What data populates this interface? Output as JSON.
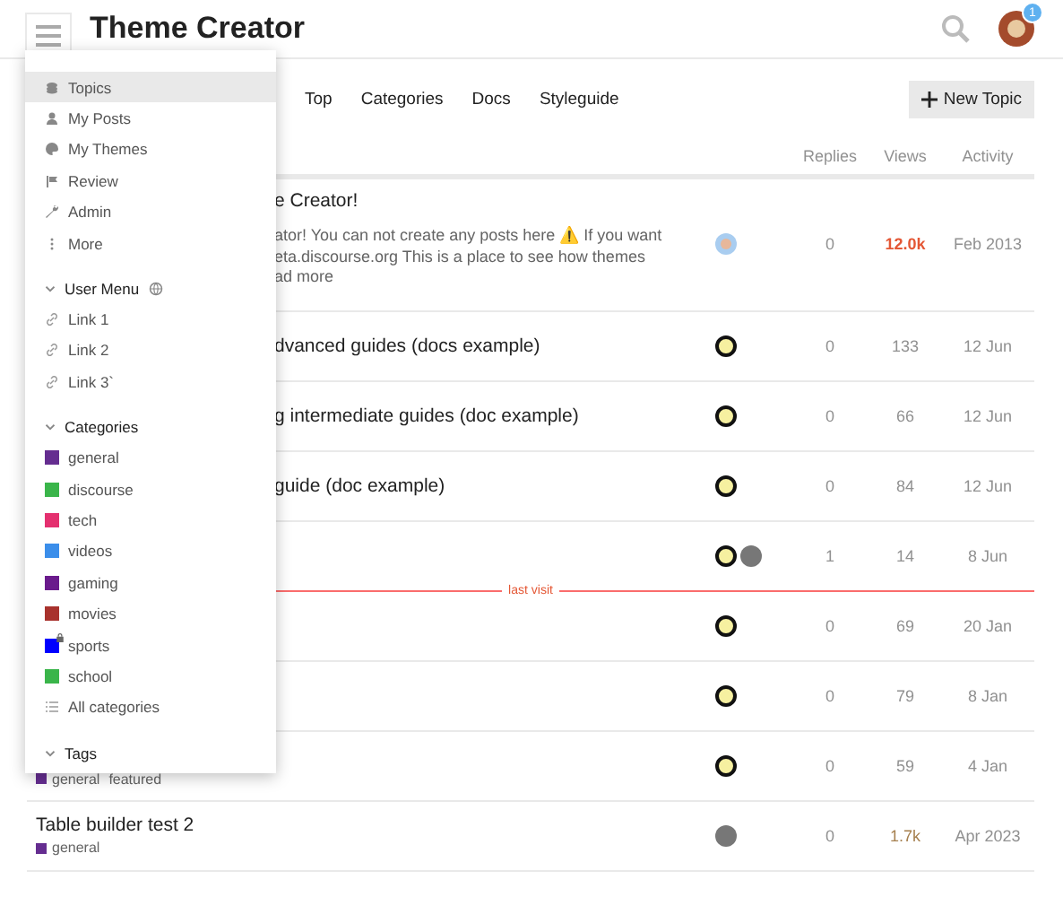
{
  "header": {
    "title": "Theme Creator",
    "notification_count": "1"
  },
  "nav": {
    "tabs": [
      {
        "label": "Top",
        "selected": false
      },
      {
        "label": "Categories",
        "selected": false
      },
      {
        "label": "Docs",
        "selected": false
      },
      {
        "label": "Styleguide",
        "selected": false
      }
    ],
    "new_topic": "New Topic"
  },
  "table": {
    "columns": [
      "Replies",
      "Views",
      "Activity"
    ],
    "rows": [
      {
        "kind": "topic",
        "title_tail": "e Creator!",
        "excerpt": [
          "ator! You can not create any posts here ⚠️ If you want",
          "eta.discourse.org This is a place to see how themes",
          "ad more"
        ],
        "avatars": [
          {
            "kind": "face"
          }
        ],
        "replies": "0",
        "views": "12.0k",
        "hot": true,
        "activity": "Feb 2013"
      },
      {
        "kind": "topic",
        "title_tail": "dvanced guides (docs example)",
        "avatars": [
          {
            "kind": "ring"
          }
        ],
        "replies": "0",
        "views": "133",
        "hot": false,
        "warm": false,
        "activity": "12 Jun"
      },
      {
        "kind": "topic",
        "title_tail": "g intermediate guides (doc example)",
        "avatars": [
          {
            "kind": "ring"
          }
        ],
        "replies": "0",
        "views": "66",
        "hot": false,
        "warm": false,
        "activity": "12 Jun"
      },
      {
        "kind": "topic",
        "title_tail": "guide (doc example)",
        "avatars": [
          {
            "kind": "ring"
          }
        ],
        "replies": "0",
        "views": "84",
        "hot": false,
        "warm": false,
        "activity": "12 Jun"
      },
      {
        "kind": "topic",
        "avatars": [
          {
            "kind": "ring"
          },
          {
            "kind": "photo"
          }
        ],
        "replies": "1",
        "views": "14",
        "hot": false,
        "warm": false,
        "activity": "8 Jun"
      },
      {
        "kind": "last_visit",
        "label": "last visit"
      },
      {
        "kind": "topic",
        "avatars": [
          {
            "kind": "ring"
          }
        ],
        "replies": "0",
        "views": "69",
        "hot": false,
        "warm": false,
        "activity": "20 Jan"
      },
      {
        "kind": "topic",
        "avatars": [
          {
            "kind": "ring"
          }
        ],
        "replies": "0",
        "views": "79",
        "hot": false,
        "warm": false,
        "activity": "8 Jan"
      },
      {
        "kind": "topic",
        "tags": [
          {
            "label": "general",
            "color": "#652d90"
          },
          {
            "label": "featured"
          }
        ],
        "avatars": [
          {
            "kind": "ring"
          }
        ],
        "replies": "0",
        "views": "59",
        "hot": false,
        "warm": false,
        "activity": "4 Jan"
      },
      {
        "kind": "topic",
        "title": "Table builder test 2",
        "tags": [
          {
            "label": "general",
            "color": "#652d90"
          }
        ],
        "avatars": [
          {
            "kind": "photo"
          }
        ],
        "replies": "0",
        "views": "1.7k",
        "hot": false,
        "warm": true,
        "activity": "Apr 2023"
      }
    ]
  },
  "menu": {
    "items": [
      {
        "label": "Topics",
        "selected": true
      },
      {
        "label": "My Posts",
        "selected": false
      },
      {
        "label": "My Themes",
        "selected": false
      },
      {
        "label": "Review",
        "selected": false
      },
      {
        "label": "Admin",
        "selected": false
      },
      {
        "label": "More",
        "selected": false
      }
    ],
    "sections": [
      {
        "title": "User Menu",
        "globe": true,
        "expanded": true,
        "items": [
          {
            "kind": "link",
            "label": "Link 1"
          },
          {
            "kind": "link",
            "label": "Link 2"
          },
          {
            "kind": "link",
            "label": "Link 3`"
          }
        ]
      },
      {
        "title": "Categories",
        "globe": false,
        "expanded": true,
        "items": [
          {
            "kind": "category",
            "label": "general",
            "color": "#652d90",
            "locked": false
          },
          {
            "kind": "category",
            "label": "discourse",
            "color": "#3ab54a",
            "locked": false
          },
          {
            "kind": "category",
            "label": "tech",
            "color": "#e4306f",
            "locked": false
          },
          {
            "kind": "category",
            "label": "videos",
            "color": "#3b8eea",
            "locked": false
          },
          {
            "kind": "category",
            "label": "gaming",
            "color": "#6a1a8c",
            "locked": false
          },
          {
            "kind": "category",
            "label": "movies",
            "color": "#a8322d",
            "locked": false
          },
          {
            "kind": "category",
            "label": "sports",
            "color": "#0000ff",
            "locked": true
          },
          {
            "kind": "category",
            "label": "school",
            "color": "#3ab54a",
            "locked": false
          },
          {
            "kind": "all",
            "label": "All categories"
          }
        ]
      },
      {
        "title": "Tags",
        "globe": false,
        "expanded": true
      }
    ]
  }
}
